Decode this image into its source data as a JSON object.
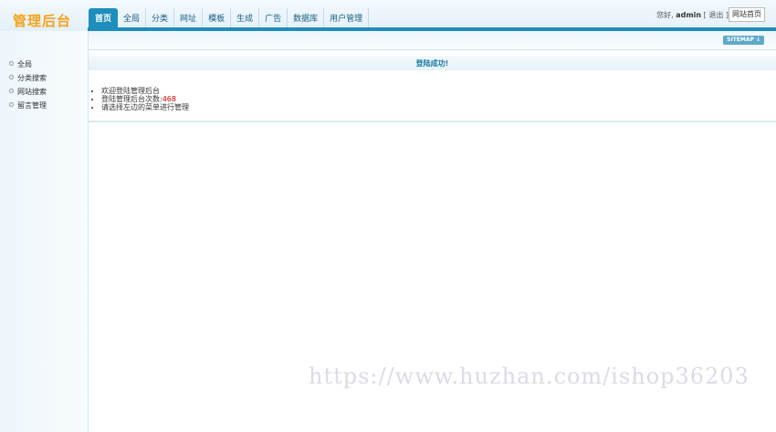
{
  "header": {
    "logo": "管理后台",
    "nav": [
      {
        "label": "首页",
        "active": true
      },
      {
        "label": "全局"
      },
      {
        "label": "分类"
      },
      {
        "label": "网址"
      },
      {
        "label": "模板"
      },
      {
        "label": "生成"
      },
      {
        "label": "广告"
      },
      {
        "label": "数据库"
      },
      {
        "label": "用户管理"
      }
    ],
    "greeting": "您好,",
    "username": "admin",
    "logout_open": "[",
    "logout": "退出",
    "logout_close": "]",
    "home_button": "网站首页"
  },
  "subbar": {
    "sitemap": "SITEMAP ↓"
  },
  "sidebar": {
    "items": [
      {
        "label": "全局"
      },
      {
        "label": "分类搜索"
      },
      {
        "label": "网站搜索"
      },
      {
        "label": "留言管理"
      }
    ]
  },
  "main": {
    "title": "登陆成功!",
    "messages": {
      "welcome": "欢迎登陆管理后台",
      "login_count_label": "登陆管理后台次数:",
      "login_count": "468",
      "hint": "请选择左边的菜单进行管理"
    }
  },
  "watermark": "https://www.huzhan.com/ishop36203",
  "colors": {
    "accent": "#1e8ebb",
    "logo": "#f5a21b",
    "count": "#cc0000"
  }
}
